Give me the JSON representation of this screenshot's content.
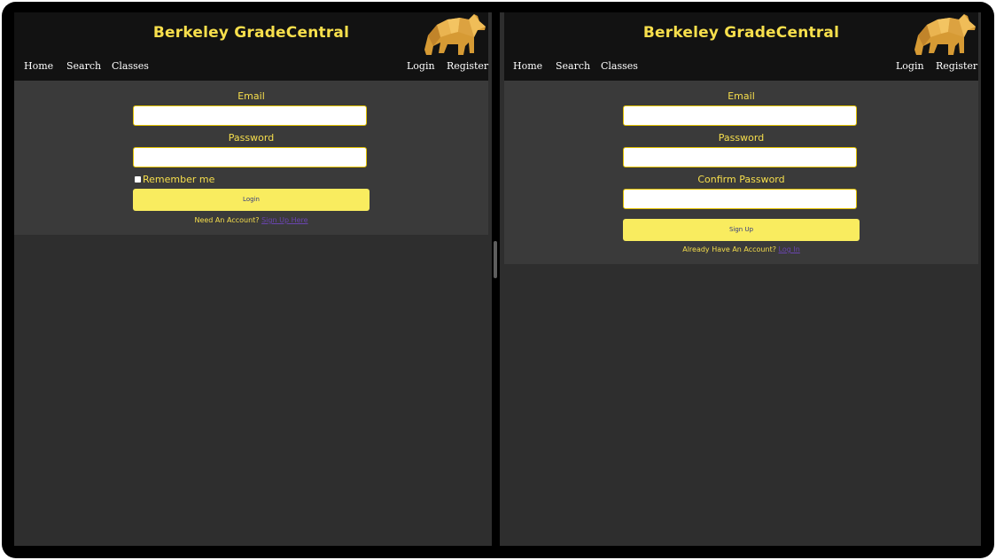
{
  "header": {
    "title": "Berkeley GradeCentral",
    "logo_icon": "bear-icon",
    "nav_left": [
      "Home",
      "Search",
      "Classes"
    ],
    "nav_right": [
      "Login",
      "Register"
    ]
  },
  "login": {
    "email_label": "Email",
    "email_value": "",
    "password_label": "Password",
    "password_value": "",
    "remember_label": "Remember me",
    "remember_checked": false,
    "submit_label": "Login",
    "footer_prompt": "Need An Account?",
    "footer_link": "Sign Up Here"
  },
  "signup": {
    "email_label": "Email",
    "email_value": "",
    "password_label": "Password",
    "password_value": "",
    "confirm_label": "Confirm Password",
    "confirm_value": "",
    "submit_label": "Sign Up",
    "footer_prompt": "Already Have An Account?",
    "footer_link": "Log In"
  },
  "colors": {
    "accent_yellow": "#f7df4c",
    "button_yellow": "#f9ec5f",
    "header_bg": "#121212",
    "content_bg": "#3a3a3a",
    "page_bg": "#2e2e2e",
    "link_purple": "#6a45b0"
  }
}
